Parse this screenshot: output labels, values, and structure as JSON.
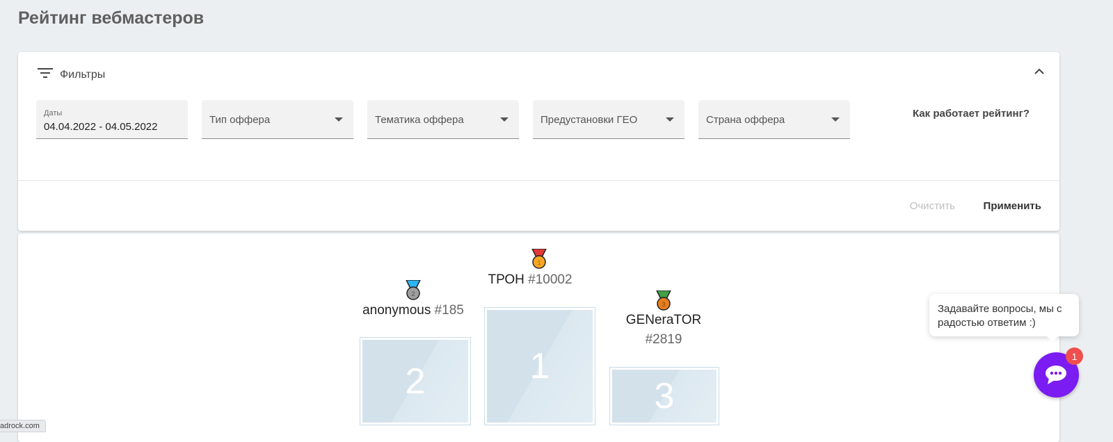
{
  "page": {
    "title": "Рейтинг вебмастеров"
  },
  "filters": {
    "title": "Фильтры",
    "date": {
      "label": "Даты",
      "value": "04.04.2022 - 04.05.2022"
    },
    "offer_type": {
      "placeholder": "Тип оффера"
    },
    "offer_theme": {
      "placeholder": "Тематика оффера"
    },
    "geo_presets": {
      "placeholder": "Предустановки ГЕО"
    },
    "offer_country": {
      "placeholder": "Страна оффера"
    },
    "how_link": "Как работает рейтинг?",
    "clear_label": "Очистить",
    "apply_label": "Применить"
  },
  "podium": [
    {
      "place": "1",
      "name": "ТРОН",
      "rank": "#10002",
      "medal_color": "#f5a623",
      "ribbon_color": "#e53935"
    },
    {
      "place": "2",
      "name": "anonymous",
      "rank": "#185",
      "medal_color": "#9e9e9e",
      "ribbon_color": "#29b6f6"
    },
    {
      "place": "3",
      "name": "GENeraTOR",
      "rank": "#2819",
      "medal_color": "#e67e22",
      "ribbon_color": "#43a047"
    }
  ],
  "chat": {
    "message": "Задавайте вопросы, мы с радостью ответим :)",
    "badge_count": "1"
  },
  "status_bar": {
    "url": "adrock.com"
  },
  "colors": {
    "accent": "#7b1cf2",
    "badge": "#ef4f4f"
  }
}
